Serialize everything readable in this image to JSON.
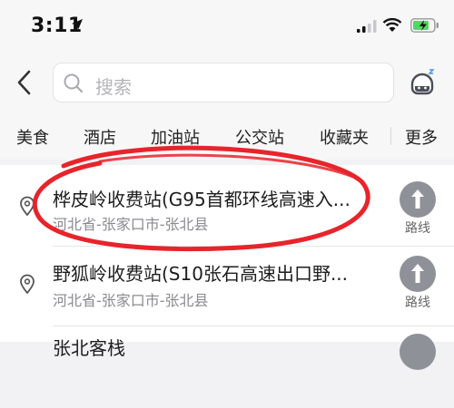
{
  "status_bar": {
    "time": "3:11",
    "icons": [
      "location-arrow-icon",
      "cellular-signal-icon",
      "wifi-icon",
      "battery-charging-icon"
    ]
  },
  "search": {
    "placeholder": "搜索",
    "back_icon": "chevron-left-icon",
    "search_icon": "magnifier-icon",
    "assistant_icon": "robot-assistant-icon"
  },
  "tabs": [
    "美食",
    "酒店",
    "加油站",
    "公交站",
    "收藏夹",
    "更多"
  ],
  "results": [
    {
      "title": "桦皮岭收费站(G95首都环线高速入...",
      "subtitle": "河北省-张家口市-张北县",
      "route_label": "路线",
      "highlighted": true
    },
    {
      "title": "野狐岭收费站(S10张石高速出口野...",
      "subtitle": "河北省-张家口市-张北县",
      "route_label": "路线",
      "highlighted": false
    },
    {
      "title": "张北客栈",
      "subtitle": "",
      "route_label": "",
      "highlighted": false
    }
  ],
  "colors": {
    "annotation_red": "#e8242b",
    "route_button": "#8e9298",
    "battery_green": "#4cd964"
  }
}
